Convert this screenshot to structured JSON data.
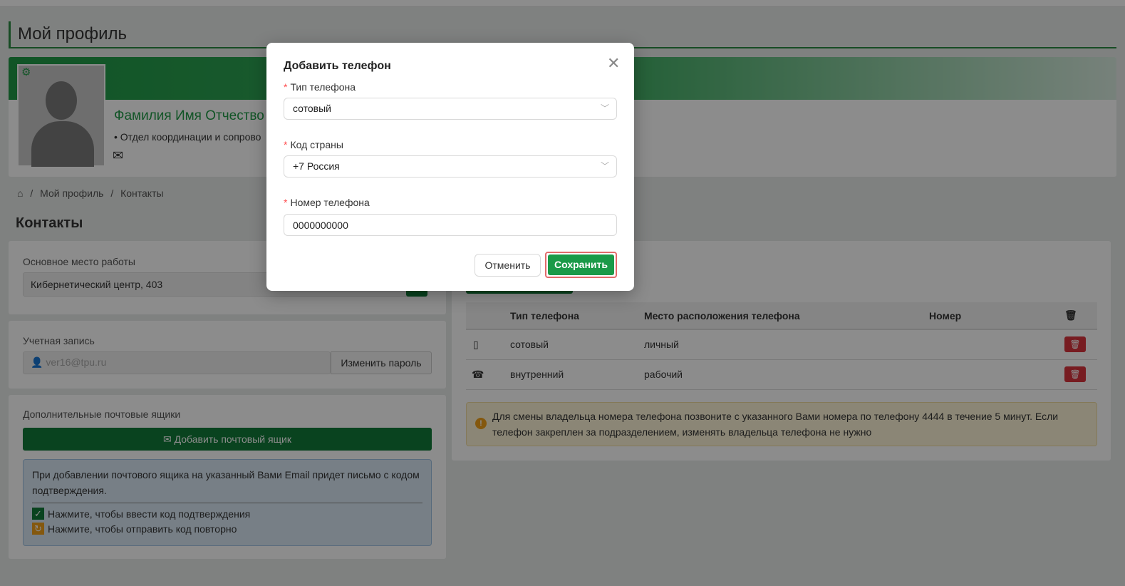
{
  "page": {
    "title": "Мой профиль"
  },
  "profile": {
    "name": "Фамилия Имя Отчество",
    "department": "Отдел координации и сопрово"
  },
  "breadcrumb": {
    "items": [
      "Мой профиль",
      "Контакты"
    ],
    "separator": "/"
  },
  "contacts": {
    "title": "Контакты",
    "workplace_label": "Основное место работы",
    "workplace_value": "Кибернетический центр, 403",
    "account_label": "Учетная запись",
    "account_placeholder": "ver16@tpu.ru",
    "change_password_label": "Изменить пароль",
    "mailboxes_label": "Дополнительные почтовые ящики",
    "add_mailbox_label": "Добавить почтовый ящик",
    "info_text": "При добавлении почтового ящика на указанный Вами Email придет письмо с кодом подтверждения.",
    "enter_code_link": "Нажмите, чтобы ввести код подтверждения",
    "resend_code_link": "Нажмите, чтобы отправить код повторно"
  },
  "phones": {
    "columns": [
      "Тип телефона",
      "Место расположения телефона",
      "Номер"
    ],
    "rows": [
      {
        "type": "сотовый",
        "location": "личный",
        "number": "",
        "icon": "mobile-icon"
      },
      {
        "type": "внутренний",
        "location": "рабочий",
        "number": "",
        "icon": "desk-phone-icon"
      }
    ],
    "warning": "Для смены владельца номера телефона позвоните с указанного Вами номера по телефону 4444 в течение 5 минут. Если телефон закреплен за подразделением, изменять владельца телефона не нужно"
  },
  "modal": {
    "title": "Добавить телефон",
    "phone_type_label": "Тип телефона",
    "phone_type_value": "сотовый",
    "country_code_label": "Код страны",
    "country_code_value": "+7 Россия",
    "phone_number_label": "Номер телефона",
    "phone_number_value": "0000000000",
    "cancel_label": "Отменить",
    "save_label": "Сохранить"
  },
  "colors": {
    "brand_green": "#127a39",
    "save_green": "#1a9a48",
    "required_red": "#ff4d4f",
    "delete_red": "#d9343c",
    "warning_bg": "#fdf5d8"
  }
}
